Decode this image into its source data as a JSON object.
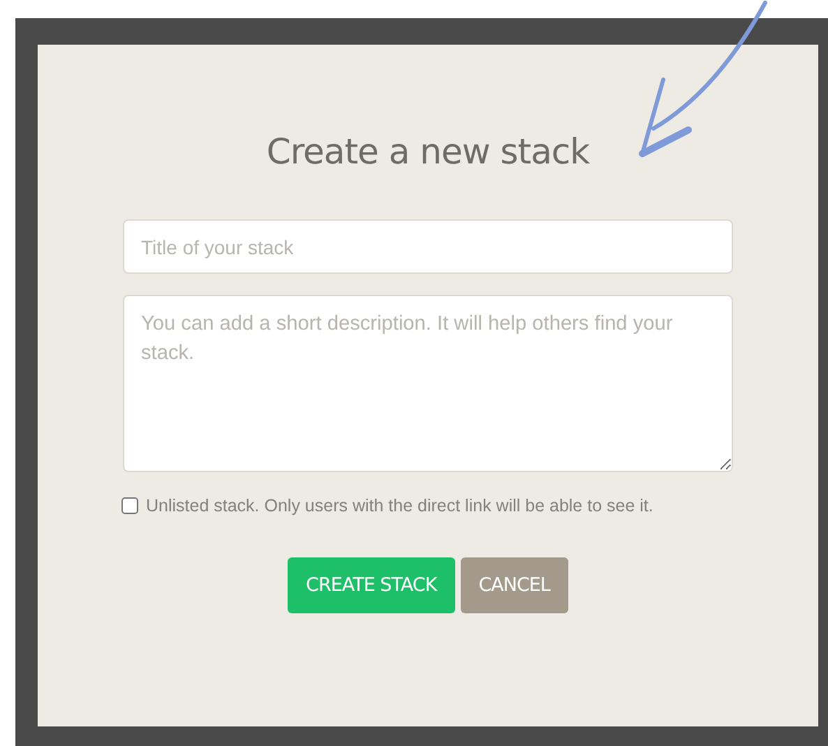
{
  "dialog": {
    "title": "Create a new stack",
    "title_field": {
      "placeholder": "Title of your stack"
    },
    "description_field": {
      "placeholder": "You can add a short description. It will help others find your stack."
    },
    "unlisted_option": {
      "label": "Unlisted stack. Only users with the direct link will be able to see it.",
      "checked": false
    },
    "buttons": [
      {
        "label": "CREATE STACK",
        "kind": "primary"
      },
      {
        "label": "CANCEL",
        "kind": "secondary"
      }
    ]
  }
}
